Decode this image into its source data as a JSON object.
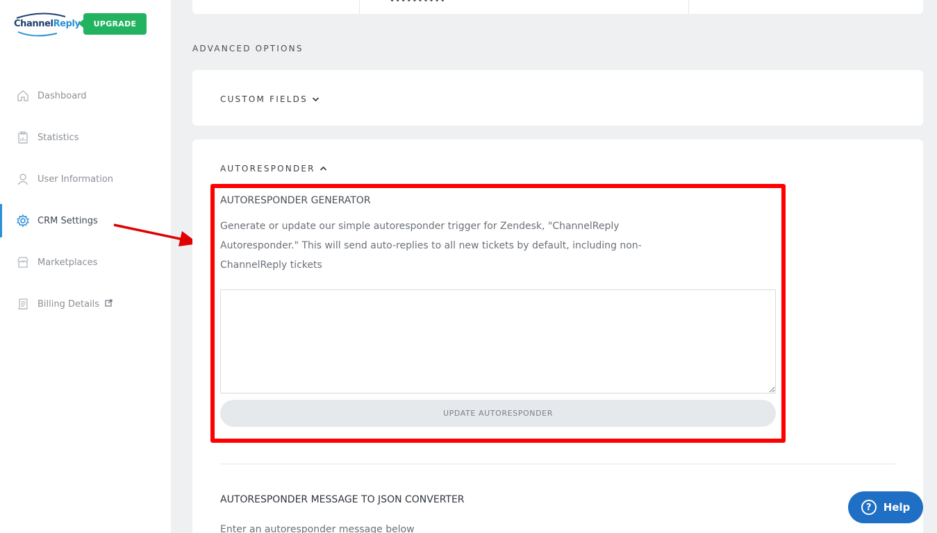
{
  "brand": {
    "logo_part1": "Channel",
    "logo_part2": "Reply",
    "upgrade_label": "UPGRADE",
    "colors": {
      "accent": "#2a8fd6",
      "upgrade": "#21b35f",
      "highlight": "#ff0000",
      "help": "#1f6fc5"
    }
  },
  "sidebar": {
    "items": [
      {
        "label": "Dashboard",
        "icon": "home-icon",
        "active": false
      },
      {
        "label": "Statistics",
        "icon": "clipboard-chart-icon",
        "active": false
      },
      {
        "label": "User Information",
        "icon": "user-icon",
        "active": false
      },
      {
        "label": "CRM Settings",
        "icon": "gear-icon",
        "active": true
      },
      {
        "label": "Marketplaces",
        "icon": "store-icon",
        "active": false
      },
      {
        "label": "Billing Details",
        "icon": "receipt-icon",
        "active": false,
        "external": true
      }
    ]
  },
  "top_card": {
    "masked_value": "••••••••••"
  },
  "main": {
    "section_title": "ADVANCED OPTIONS",
    "custom_fields": {
      "label": "CUSTOM FIELDS",
      "expanded": false
    },
    "autoresponder": {
      "label": "AUTORESPONDER",
      "expanded": true,
      "generator": {
        "title": "AUTORESPONDER GENERATOR",
        "description": "Generate or update our simple autoresponder trigger for Zendesk, \"ChannelReply Autoresponder.\" This will send auto-replies to all new tickets by default, including non-ChannelReply tickets",
        "textarea_value": "",
        "button_label": "UPDATE AUTORESPONDER"
      },
      "json_converter": {
        "title": "AUTORESPONDER MESSAGE TO JSON CONVERTER",
        "hint": "Enter an autoresponder message below"
      }
    }
  },
  "help": {
    "label": "Help"
  }
}
